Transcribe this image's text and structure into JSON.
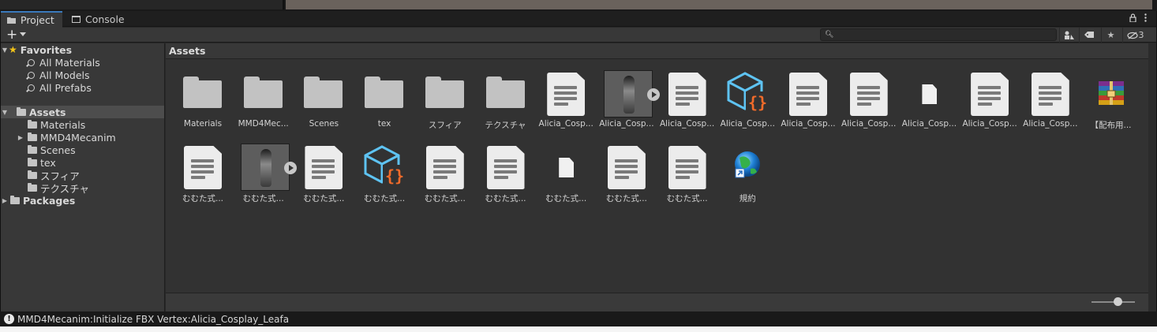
{
  "tabs": [
    {
      "label": "Project",
      "active": true,
      "icon": "folder-icon"
    },
    {
      "label": "Console",
      "active": false,
      "icon": "console-icon"
    }
  ],
  "toolbar": {
    "add_label": "+",
    "hidden_count": "3",
    "search_placeholder": ""
  },
  "sidebar": {
    "favorites": {
      "label": "Favorites",
      "items": [
        "All Materials",
        "All Models",
        "All Prefabs"
      ]
    },
    "assets": {
      "label": "Assets",
      "items": [
        "Materials",
        "MMD4Mecanim",
        "Scenes",
        "tex",
        "スフィア",
        "テクスチャ"
      ]
    },
    "packages": {
      "label": "Packages"
    }
  },
  "main": {
    "path": "Assets",
    "row1": [
      {
        "label": "Materials",
        "type": "folder"
      },
      {
        "label": "MMD4Mec...",
        "type": "folder"
      },
      {
        "label": "Scenes",
        "type": "folder"
      },
      {
        "label": "tex",
        "type": "folder"
      },
      {
        "label": "スフィア",
        "type": "folder"
      },
      {
        "label": "テクスチャ",
        "type": "folder"
      },
      {
        "label": "Alicia_Cosp...",
        "type": "doc"
      },
      {
        "label": "Alicia_Cosp...",
        "type": "model"
      },
      {
        "label": "Alicia_Cosp...",
        "type": "doc"
      },
      {
        "label": "Alicia_Cosp...",
        "type": "json"
      },
      {
        "label": "Alicia_Cosp...",
        "type": "doc"
      },
      {
        "label": "Alicia_Cosp...",
        "type": "doc"
      },
      {
        "label": "Alicia_Cosp...",
        "type": "smalldoc"
      },
      {
        "label": "Alicia_Cosp...",
        "type": "doc"
      },
      {
        "label": "Alicia_Cosp...",
        "type": "doc"
      },
      {
        "label": "【配布用...",
        "type": "archive"
      }
    ],
    "row2": [
      {
        "label": "むむた式...",
        "type": "doc"
      },
      {
        "label": "むむた式...",
        "type": "model"
      },
      {
        "label": "むむた式...",
        "type": "doc"
      },
      {
        "label": "むむた式...",
        "type": "json"
      },
      {
        "label": "むむた式...",
        "type": "doc"
      },
      {
        "label": "むむた式...",
        "type": "doc"
      },
      {
        "label": "むむた式...",
        "type": "smalldoc"
      },
      {
        "label": "むむた式...",
        "type": "doc"
      },
      {
        "label": "むむた式...",
        "type": "doc"
      },
      {
        "label": "規約",
        "type": "weblink"
      }
    ],
    "zoom_level": 0.6
  },
  "status": {
    "message": "MMD4Mecanim:Initialize FBX Vertex:Alicia_Cosplay_Leafa"
  },
  "colors": {
    "accent": "#3a79bb",
    "json_blue": "#5ec3f2",
    "json_orange": "#f26b2a",
    "star": "#f5c518"
  }
}
